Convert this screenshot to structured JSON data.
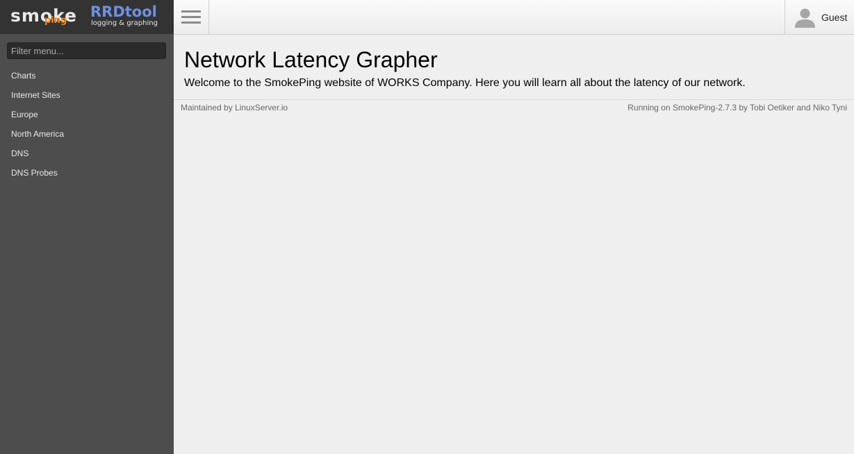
{
  "logo": {
    "smoke": "smoke",
    "ping": "ping",
    "rrdtool": "RRDtool",
    "rrdtool_sub": "logging & graphing"
  },
  "sidebar": {
    "filter_placeholder": "Filter menu...",
    "items": [
      {
        "label": "Charts"
      },
      {
        "label": "Internet Sites"
      },
      {
        "label": "Europe"
      },
      {
        "label": "North America"
      },
      {
        "label": "DNS"
      },
      {
        "label": "DNS Probes"
      }
    ]
  },
  "topbar": {
    "user": "Guest"
  },
  "main": {
    "title": "Network Latency Grapher",
    "welcome": "Welcome to the SmokePing website of WORKS Company. Here you will learn all about the latency of our network."
  },
  "footer": {
    "maintained": "Maintained by LinuxServer.io",
    "running": "Running on SmokePing-2.7.3 by Tobi Oetiker and Niko Tyni"
  },
  "colors": {
    "sidebar_bg": "#4d4d4d",
    "logo_bg": "#333333",
    "ping_orange": "#f28a1c",
    "rrdtool_blue": "#6f8fe0",
    "page_bg": "#efefef"
  },
  "icons": {
    "menu": "hamburger-menu-icon",
    "user": "user-icon"
  }
}
